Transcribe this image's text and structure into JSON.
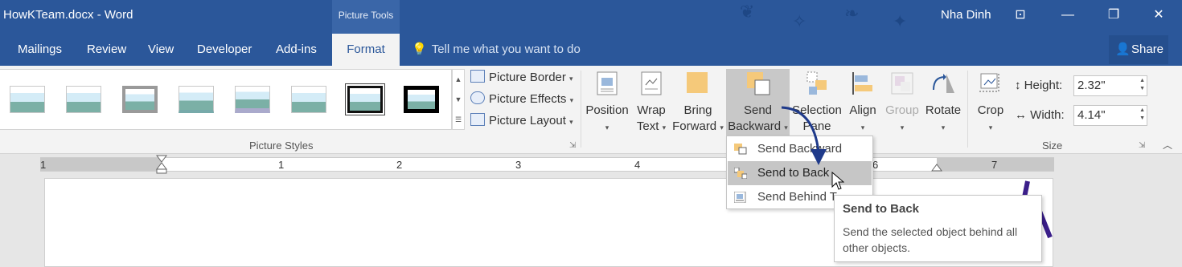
{
  "titlebar": {
    "doc_title": "HowKTeam.docx - Word",
    "context_tools": "Picture Tools",
    "user": "Nha Dinh"
  },
  "tabs": [
    {
      "label": "Mailings"
    },
    {
      "label": "Review"
    },
    {
      "label": "View"
    },
    {
      "label": "Developer"
    },
    {
      "label": "Add-ins"
    },
    {
      "label": "Format"
    }
  ],
  "tell_me": "Tell me what you want to do",
  "share": "Share",
  "picture_styles": {
    "commands": [
      {
        "label": "Picture Border",
        "icon": "picture-border-icon"
      },
      {
        "label": "Picture Effects",
        "icon": "picture-effects-icon"
      },
      {
        "label": "Picture Layout",
        "icon": "picture-layout-icon"
      }
    ],
    "group_label": "Picture Styles"
  },
  "arrange": {
    "position": "Position",
    "wrap_text_1": "Wrap",
    "wrap_text_2": "Text",
    "bring_forward_1": "Bring",
    "bring_forward_2": "Forward",
    "send_backward_1": "Send",
    "send_backward_2": "Backward",
    "selection_pane_1": "Selection",
    "selection_pane_2": "Pane",
    "align": "Align",
    "group": "Group",
    "rotate": "Rotate"
  },
  "size": {
    "crop": "Crop",
    "height_label": "Height:",
    "height_value": "2.32\"",
    "width_label": "Width:",
    "width_value": "4.14\"",
    "group_label": "Size"
  },
  "ruler": {
    "numbers": [
      "1",
      "1",
      "2",
      "3",
      "4",
      "6",
      "7"
    ]
  },
  "menu": {
    "items": [
      {
        "label": "Send Backward"
      },
      {
        "label": "Send to Back"
      },
      {
        "label": "Send Behind T"
      }
    ]
  },
  "tooltip": {
    "title": "Send to Back",
    "body": "Send the selected object behind all other objects."
  },
  "colors": {
    "brand": "#2b579a",
    "ribbon": "#f3f3f3",
    "hover": "#c6c6c6",
    "arrow": "#1f3a8a",
    "watermark": "#3b1f8a"
  }
}
